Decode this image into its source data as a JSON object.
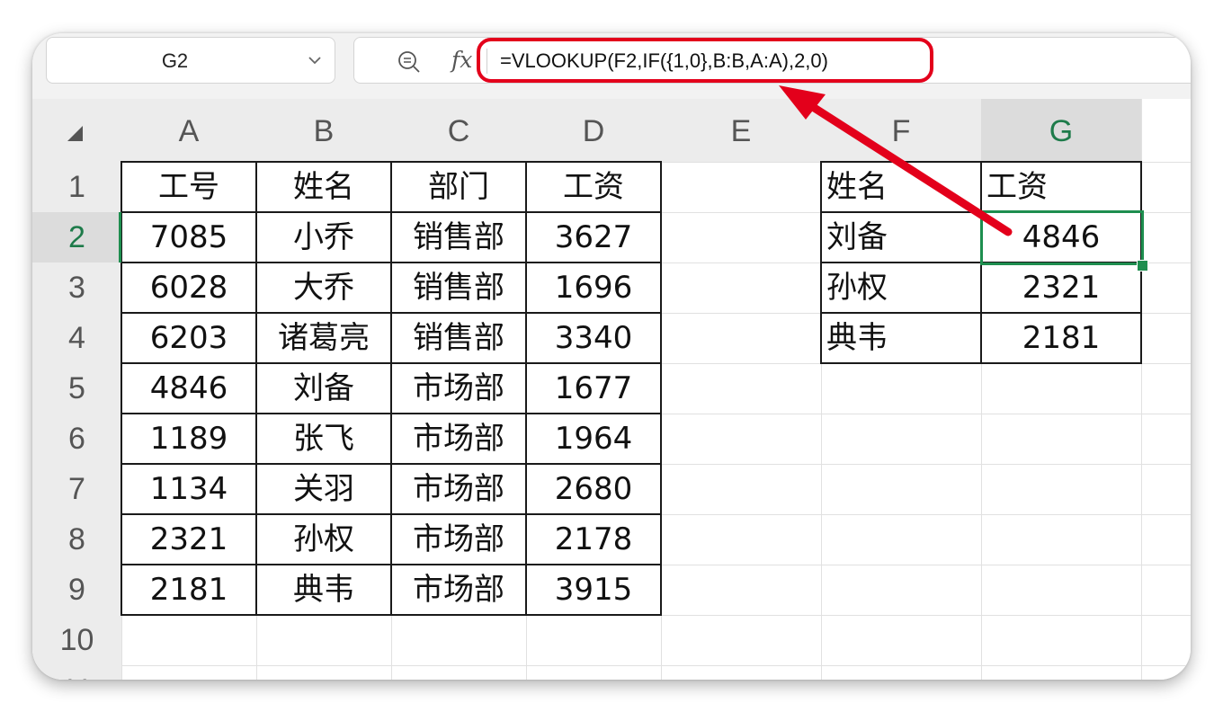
{
  "toolbar": {
    "name_box_value": "G2",
    "zoom_icon": "zoom-icon",
    "fx_label": "fx",
    "formula": "=VLOOKUP(F2,IF({1,0},B:B,A:A),2,0)"
  },
  "columns": [
    "A",
    "B",
    "C",
    "D",
    "E",
    "F",
    "G"
  ],
  "selected_column": "G",
  "rows": [
    "1",
    "2",
    "3",
    "4",
    "5",
    "6",
    "7",
    "8",
    "9",
    "10",
    "11"
  ],
  "selected_row": "2",
  "main_table": [
    [
      "工号",
      "姓名",
      "部门",
      "工资"
    ],
    [
      "7085",
      "小乔",
      "销售部",
      "3627"
    ],
    [
      "6028",
      "大乔",
      "销售部",
      "1696"
    ],
    [
      "6203",
      "诸葛亮",
      "销售部",
      "3340"
    ],
    [
      "4846",
      "刘备",
      "市场部",
      "1677"
    ],
    [
      "1189",
      "张飞",
      "市场部",
      "1964"
    ],
    [
      "1134",
      "关羽",
      "市场部",
      "2680"
    ],
    [
      "2321",
      "孙权",
      "市场部",
      "2178"
    ],
    [
      "2181",
      "典韦",
      "市场部",
      "3915"
    ]
  ],
  "lookup_table": [
    [
      "姓名",
      "工资"
    ],
    [
      "刘备",
      "4846"
    ],
    [
      "孙权",
      "2321"
    ],
    [
      "典韦",
      "2181"
    ]
  ],
  "colors": {
    "selection": "#1e8e4f",
    "annotation": "#e3001b"
  }
}
